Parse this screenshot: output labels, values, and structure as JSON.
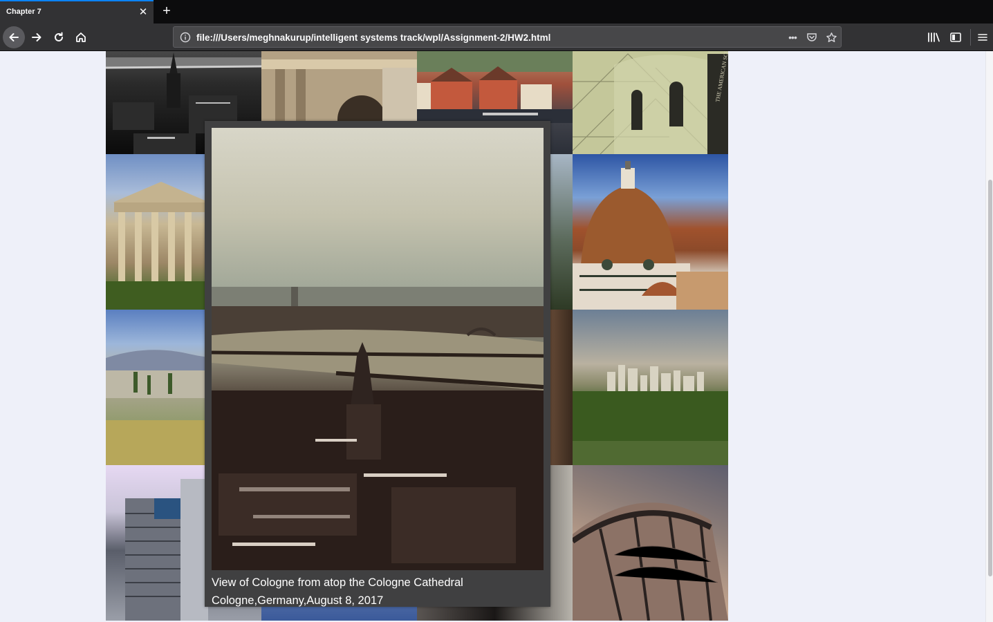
{
  "browser": {
    "tab_title": "Chapter 7",
    "url": "file:///Users/meghnakurup/intelligent systems track/wpl/Assignment-2/HW2.html",
    "url_overflow_label": "•••"
  },
  "gallery": {
    "tiles": [
      {
        "id": "t1",
        "icon": "city-bw-photo"
      },
      {
        "id": "t2",
        "icon": "arch-photo"
      },
      {
        "id": "t3",
        "icon": "waterfront-photo"
      },
      {
        "id": "t4",
        "icon": "museum-roof-photo",
        "sign_text": "THE AMERICAN SCENE"
      },
      {
        "id": "t5",
        "icon": "temple-photo"
      },
      {
        "id": "t8",
        "icon": "duomo-photo"
      },
      {
        "id": "t9",
        "icon": "hillside-photo"
      },
      {
        "id": "t12",
        "icon": "skyline-photo"
      },
      {
        "id": "t13",
        "icon": "tower-photo"
      },
      {
        "id": "t16",
        "icon": "curved-roof-photo"
      }
    ]
  },
  "lightbox": {
    "caption_title": "View of Cologne from atop the Cologne Cathedral",
    "caption_place_date": "Cologne,Germany,August 8, 2017"
  }
}
